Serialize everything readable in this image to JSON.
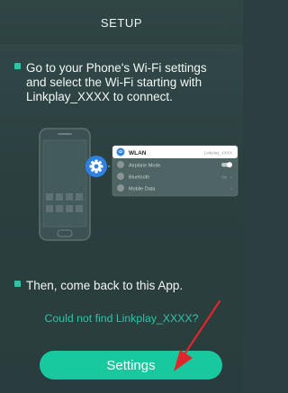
{
  "header": {
    "title": "SETUP"
  },
  "steps": [
    {
      "text": "Go to your Phone's Wi-Fi settings and select the Wi-Fi starting with Linkplay_XXXX to connect."
    },
    {
      "text": "Then, come back to this App."
    }
  ],
  "illustration": {
    "rows": [
      {
        "label": "WLAN",
        "value": "Linkplay_XXXX",
        "icon": "wifi-icon",
        "icon_color": "#2f80e0"
      },
      {
        "label": "Airplane Mode",
        "value": "",
        "icon": "airplane-icon",
        "icon_color": "#8a9496"
      },
      {
        "label": "Bluetooth",
        "value": "On",
        "icon": "bluetooth-icon",
        "icon_color": "#8a9496"
      },
      {
        "label": "Mobile Data",
        "value": "",
        "icon": "mobile-data-icon",
        "icon_color": "#8a9496"
      }
    ]
  },
  "help_link": "Could not find Linkplay_XXXX?",
  "button": {
    "label": "Settings"
  },
  "colors": {
    "accent": "#18c99f",
    "link": "#2ec4a6",
    "arrow": "#e0262b"
  }
}
